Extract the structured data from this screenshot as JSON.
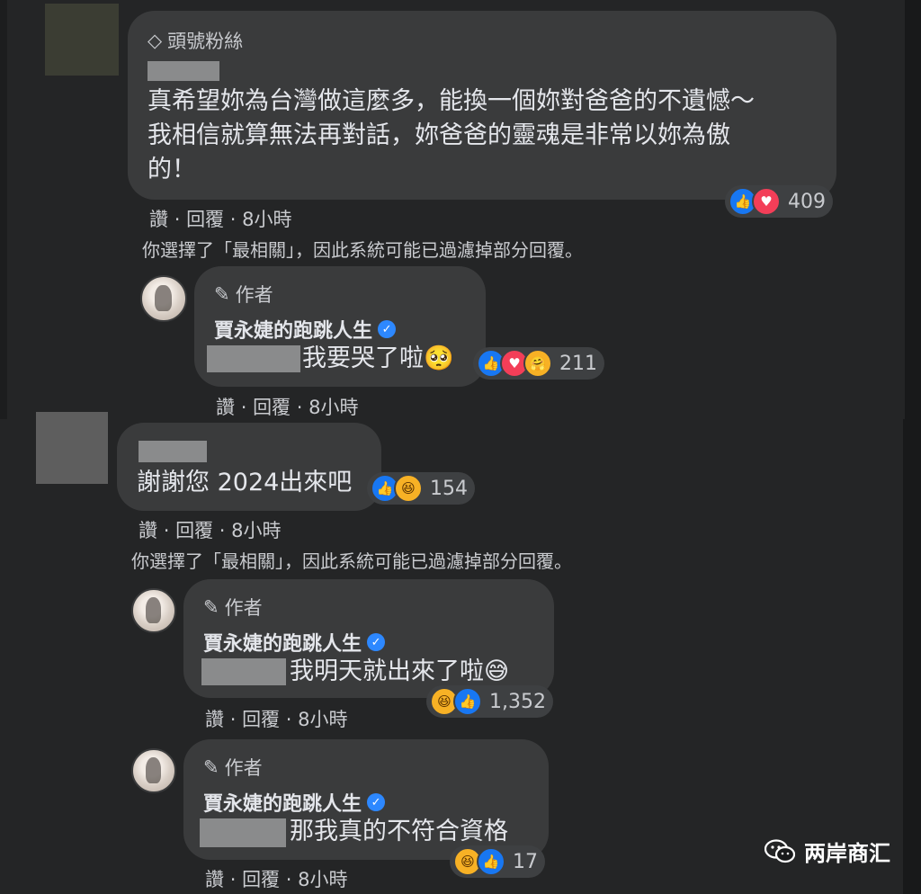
{
  "comments": [
    {
      "badge_label": "頭號粉絲",
      "text_lines": [
        "真希望妳為台灣做這麼多，能換一個妳對爸爸的不遺憾～",
        "我相信就算無法再對話，妳爸爸的靈魂是非常以妳為傲",
        "的！"
      ],
      "reaction_count": "409",
      "reaction_icons": [
        "like",
        "love"
      ],
      "action_like": "讚",
      "action_reply": "回覆",
      "timestamp": "8小時",
      "filter_notice": "你選擇了「最相關」，因此系統可能已過濾掉部分回覆。",
      "reply": {
        "author_tag": "作者",
        "author_name": "賈永婕的跑跳人生",
        "text": "我要哭了啦🥺",
        "reaction_count": "211",
        "reaction_icons": [
          "like",
          "love",
          "care"
        ],
        "action_like": "讚",
        "action_reply": "回覆",
        "timestamp": "8小時"
      }
    },
    {
      "text": "謝謝您 2024出來吧",
      "reaction_count": "154",
      "reaction_icons": [
        "like",
        "haha"
      ],
      "action_like": "讚",
      "action_reply": "回覆",
      "timestamp": "8小時",
      "filter_notice": "你選擇了「最相關」，因此系統可能已過濾掉部分回覆。",
      "replies": [
        {
          "author_tag": "作者",
          "author_name": "賈永婕的跑跳人生",
          "text": "我明天就出來了啦😅",
          "reaction_count": "1,352",
          "reaction_icons": [
            "haha",
            "like"
          ],
          "action_like": "讚",
          "action_reply": "回覆",
          "timestamp": "8小時"
        },
        {
          "author_tag": "作者",
          "author_name": "賈永婕的跑跳人生",
          "text": "那我真的不符合資格",
          "reaction_count": "17",
          "reaction_icons": [
            "haha",
            "like"
          ],
          "action_like": "讚",
          "action_reply": "回覆",
          "timestamp": "8小時"
        }
      ]
    }
  ],
  "watermark": {
    "text": "两岸商汇",
    "icon": "wechat-icon"
  },
  "dot": "·",
  "icons": {
    "like": "👍",
    "love": "♥",
    "haha": "😆",
    "care": "🤗",
    "pencil": "✎",
    "diamond": "◇",
    "check": "✓"
  }
}
